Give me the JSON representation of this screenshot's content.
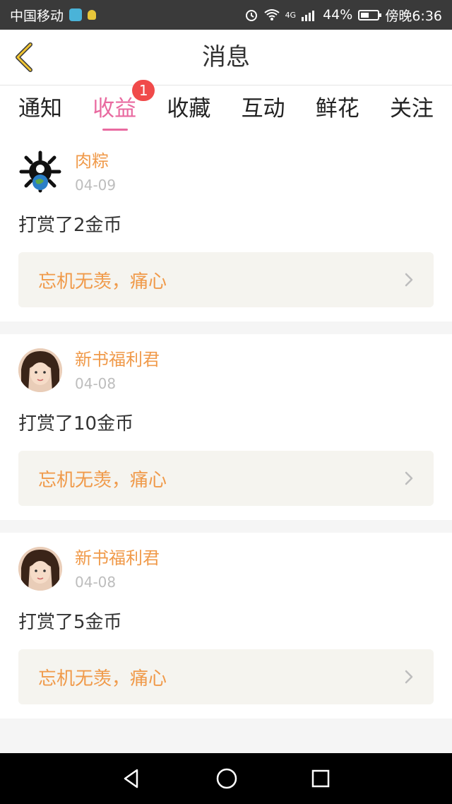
{
  "status_bar": {
    "carrier": "中国移动",
    "battery": "44%",
    "time": "傍晚6:36",
    "network": "4G"
  },
  "header": {
    "title": "消息"
  },
  "tabs": [
    {
      "label": "通知",
      "active": false
    },
    {
      "label": "收益",
      "active": true,
      "badge": "1"
    },
    {
      "label": "收藏",
      "active": false
    },
    {
      "label": "互动",
      "active": false
    },
    {
      "label": "鲜花",
      "active": false
    },
    {
      "label": "关注",
      "active": false
    }
  ],
  "items": [
    {
      "username": "肉粽",
      "date": "04-09",
      "action": "打赏了2金币",
      "book": "忘机无羡，痛心",
      "avatar_icon": "gear-globe-avatar"
    },
    {
      "username": "新书福利君",
      "date": "04-08",
      "action": "打赏了10金币",
      "book": "忘机无羡，痛心",
      "avatar_icon": "girl-avatar"
    },
    {
      "username": "新书福利君",
      "date": "04-08",
      "action": "打赏了5金币",
      "book": "忘机无羡，痛心",
      "avatar_icon": "girl-avatar"
    }
  ],
  "colors": {
    "accent_pink": "#e96aa0",
    "username_orange": "#f09a4a",
    "badge_red": "#f04a4a"
  }
}
